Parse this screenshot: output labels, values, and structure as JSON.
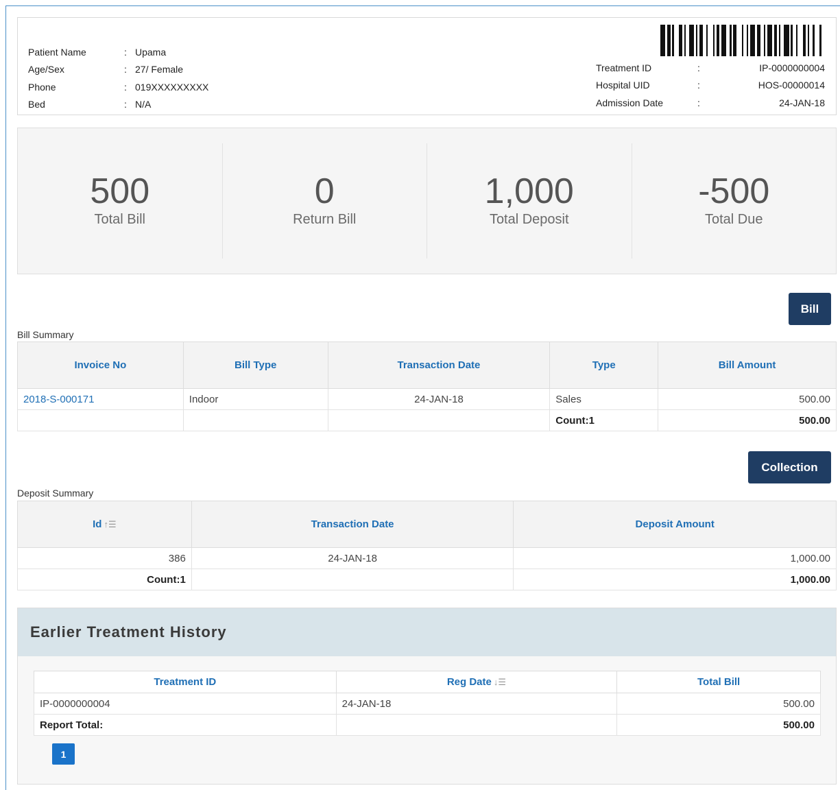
{
  "patient": {
    "name_label": "Patient Name",
    "name": "Upama",
    "age_label": "Age/Sex",
    "age": "27/ Female",
    "phone_label": "Phone",
    "phone": "019XXXXXXXXX",
    "bed_label": "Bed",
    "bed": "N/A",
    "colon": ":"
  },
  "treatment": {
    "id_label": "Treatment ID",
    "id": "IP-0000000004",
    "uid_label": "Hospital UID",
    "uid": "HOS-00000014",
    "adm_label": "Admission Date",
    "adm": "24-JAN-18"
  },
  "stats": [
    {
      "value": "500",
      "label": "Total Bill"
    },
    {
      "value": "0",
      "label": "Return Bill"
    },
    {
      "value": "1,000",
      "label": "Total Deposit"
    },
    {
      "value": "-500",
      "label": "Total Due"
    }
  ],
  "bill_summary": {
    "title": "Bill Summary",
    "button": "Bill",
    "headers": [
      "Invoice No",
      "Bill Type",
      "Transaction Date",
      "Type",
      "Bill Amount"
    ],
    "row": {
      "invoice": "2018-S-000171",
      "bill_type": "Indoor",
      "date": "24-JAN-18",
      "type": "Sales",
      "amount": "500.00"
    },
    "count": "Count:1",
    "total": "500.00"
  },
  "deposit_summary": {
    "title": "Deposit Summary",
    "button": "Collection",
    "headers": [
      "Id",
      "Transaction Date",
      "Deposit Amount"
    ],
    "row": {
      "id": "386",
      "date": "24-JAN-18",
      "amount": "1,000.00"
    },
    "count": "Count:1",
    "total": "1,000.00"
  },
  "history": {
    "title": "Earlier Treatment History",
    "headers": [
      "Treatment ID",
      "Reg Date",
      "Total Bill"
    ],
    "row": {
      "id": "IP-0000000004",
      "date": "24-JAN-18",
      "bill": "500.00"
    },
    "total_label": "Report Total:",
    "total": "500.00",
    "page": "1"
  },
  "colors": {
    "accent": "#1f6fb5",
    "button": "#1f3d63",
    "header_bg": "#d8e4ea"
  }
}
